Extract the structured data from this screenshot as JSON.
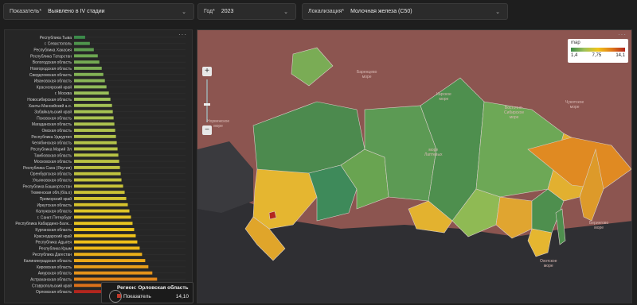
{
  "filters": [
    {
      "label": "Показатель*",
      "value": "Выявлено в IV стадии"
    },
    {
      "label": "Год*",
      "value": "2023"
    },
    {
      "label": "Локализация*",
      "value": "Молочная железа (С50)"
    }
  ],
  "bar_panel": {
    "more": "···"
  },
  "map_panel": {
    "more": "···"
  },
  "zoom": {
    "plus": "+",
    "minus": "−"
  },
  "legend": {
    "title": "map",
    "min": "1,4",
    "mid": "7,75",
    "max": "14,1"
  },
  "tooltip": {
    "title": "Регион: Орловская область",
    "metric": "Показатель",
    "value": "14,10"
  },
  "geo_labels": [
    {
      "text": "Баренцево\nморе"
    },
    {
      "text": "Карское\nморе"
    },
    {
      "text": "море\nЛаптевых"
    },
    {
      "text": "Восточно-\nСибирское\nморе"
    },
    {
      "text": "Чукотское\nморе"
    },
    {
      "text": "Берингово\nморе"
    },
    {
      "text": "Охотское\nморе"
    },
    {
      "text": "Норвежское\nморе"
    }
  ],
  "chart_data": {
    "type": "bar",
    "orientation": "horizontal",
    "scale": [
      1.4,
      14.1
    ],
    "categories": [
      "Республика Тыва",
      "г. Севастополь",
      "Республика Хакасия",
      "Республика Татарстан",
      "Вологодская область",
      "Новгородская область",
      "Свердловская область",
      "Ивановская область",
      "Красноярский край",
      "г. Москва",
      "Новосибирская область",
      "Ханты-Мансийский а.о.",
      "Забайкальский край",
      "Псковская область",
      "Магаданская область",
      "Омская область",
      "Республика Удмуртия",
      "Челябинская область",
      "Республика Марий Эл",
      "Тамбовская область",
      "Московская область",
      "Республика Саха (Якутия)",
      "Оренбургская область",
      "Ульяновская область",
      "Республика Башкортостан",
      "Тюменская обл.(б/а.о)",
      "Приморский край",
      "Иркутская область",
      "Калужская область",
      "г. Санкт-Петербург",
      "Республика Кабардино-Балк...",
      "Курганская область",
      "Краснодарский край",
      "Республика Адыгея",
      "Республика Крым",
      "Республика Дагестан",
      "Калининградская область",
      "Кировская область",
      "Амурская область",
      "Астраханская область",
      "Ставропольский край",
      "Орловская область"
    ],
    "values": [
      1.4,
      2.0,
      2.5,
      3.0,
      3.2,
      3.5,
      3.7,
      3.9,
      4.1,
      4.4,
      4.6,
      4.8,
      4.9,
      5.0,
      5.1,
      5.2,
      5.3,
      5.4,
      5.5,
      5.6,
      5.7,
      5.8,
      5.9,
      6.0,
      6.2,
      6.4,
      6.6,
      6.8,
      7.0,
      7.2,
      7.4,
      7.6,
      7.8,
      8.0,
      8.3,
      8.6,
      9.0,
      9.4,
      9.9,
      10.5,
      11.3,
      14.1
    ]
  }
}
